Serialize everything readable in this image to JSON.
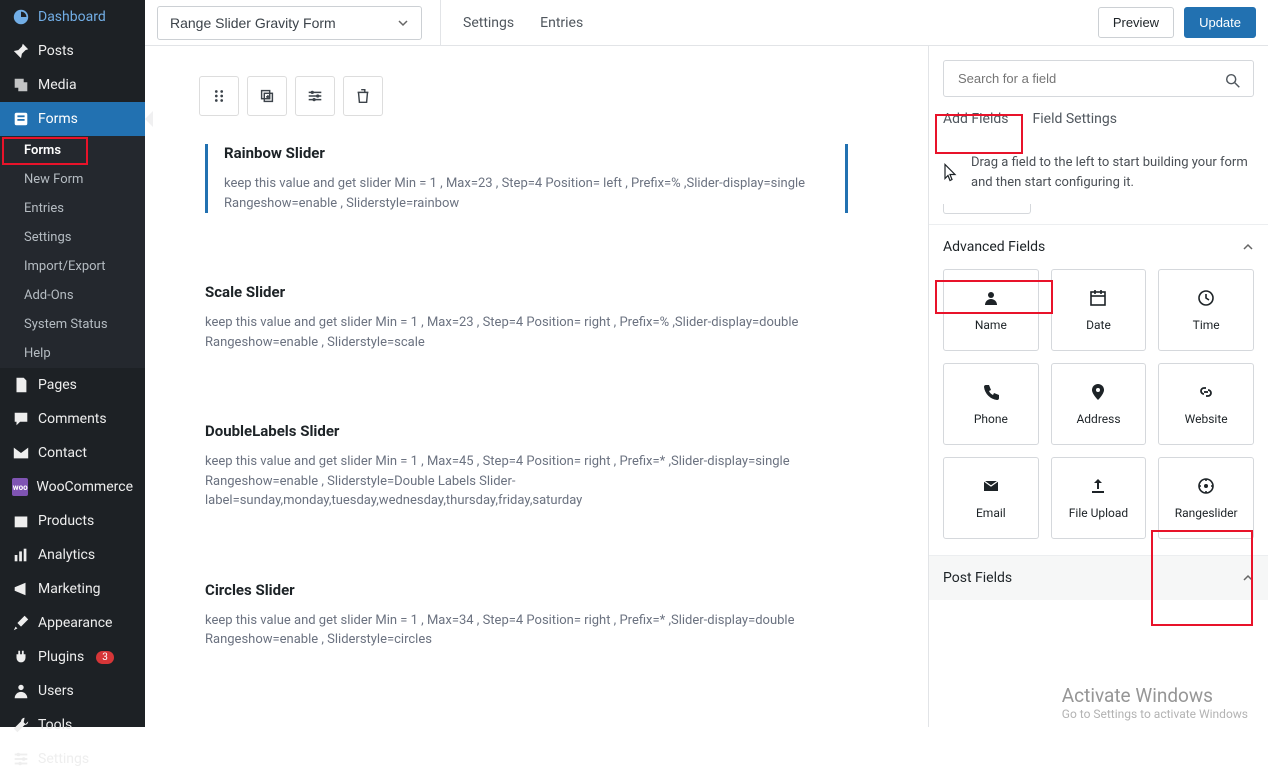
{
  "sidebar": {
    "items": [
      {
        "label": "Dashboard"
      },
      {
        "label": "Posts"
      },
      {
        "label": "Media"
      },
      {
        "label": "Forms"
      },
      {
        "label": "Pages"
      },
      {
        "label": "Comments"
      },
      {
        "label": "Contact"
      },
      {
        "label": "WooCommerce"
      },
      {
        "label": "Products"
      },
      {
        "label": "Analytics"
      },
      {
        "label": "Marketing"
      },
      {
        "label": "Appearance"
      },
      {
        "label": "Plugins"
      },
      {
        "label": "Users"
      },
      {
        "label": "Tools"
      },
      {
        "label": "Settings"
      }
    ],
    "forms_submenu": [
      {
        "label": "Forms"
      },
      {
        "label": "New Form"
      },
      {
        "label": "Entries"
      },
      {
        "label": "Settings"
      },
      {
        "label": "Import/Export"
      },
      {
        "label": "Add-Ons"
      },
      {
        "label": "System Status"
      },
      {
        "label": "Help"
      }
    ],
    "plugin_badge": "3"
  },
  "topbar": {
    "form_name": "Range Slider Gravity Form",
    "links": [
      {
        "label": "Settings"
      },
      {
        "label": "Entries"
      }
    ],
    "preview": "Preview",
    "update": "Update"
  },
  "fields": [
    {
      "title": "Rainbow Slider",
      "desc": "keep this value and get slider Min = 1 , Max=23 , Step=4 Position= left , Prefix=% ,Slider-display=single Rangeshow=enable , Sliderstyle=rainbow"
    },
    {
      "title": "Scale Slider",
      "desc": "keep this value and get slider Min = 1 , Max=23 , Step=4 Position= right , Prefix=% ,Slider-display=double Rangeshow=enable , Sliderstyle=scale"
    },
    {
      "title": "DoubleLabels Slider",
      "desc": "keep this value and get slider Min = 1 , Max=45 , Step=4 Position= right , Prefix=* ,Slider-display=single Rangeshow=enable , Sliderstyle=Double Labels Slider-label=sunday,monday,tuesday,wednesday,thursday,friday,saturday"
    },
    {
      "title": "Circles Slider",
      "desc": "keep this value and get slider Min = 1 , Max=34 , Step=4 Position= right , Prefix=* ,Slider-display=double Rangeshow=enable , Sliderstyle=circles"
    }
  ],
  "rightpanel": {
    "search_placeholder": "Search for a field",
    "tabs": {
      "add": "Add Fields",
      "settings": "Field Settings"
    },
    "hint": "Drag a field to the left to start building your form and then start configuring it.",
    "advanced_title": "Advanced Fields",
    "post_fields_title": "Post Fields",
    "advanced_fields": [
      {
        "label": "Name"
      },
      {
        "label": "Date"
      },
      {
        "label": "Time"
      },
      {
        "label": "Phone"
      },
      {
        "label": "Address"
      },
      {
        "label": "Website"
      },
      {
        "label": "Email"
      },
      {
        "label": "File Upload"
      },
      {
        "label": "Rangeslider"
      }
    ]
  },
  "watermark": {
    "title": "Activate Windows",
    "sub": "Go to Settings to activate Windows"
  }
}
